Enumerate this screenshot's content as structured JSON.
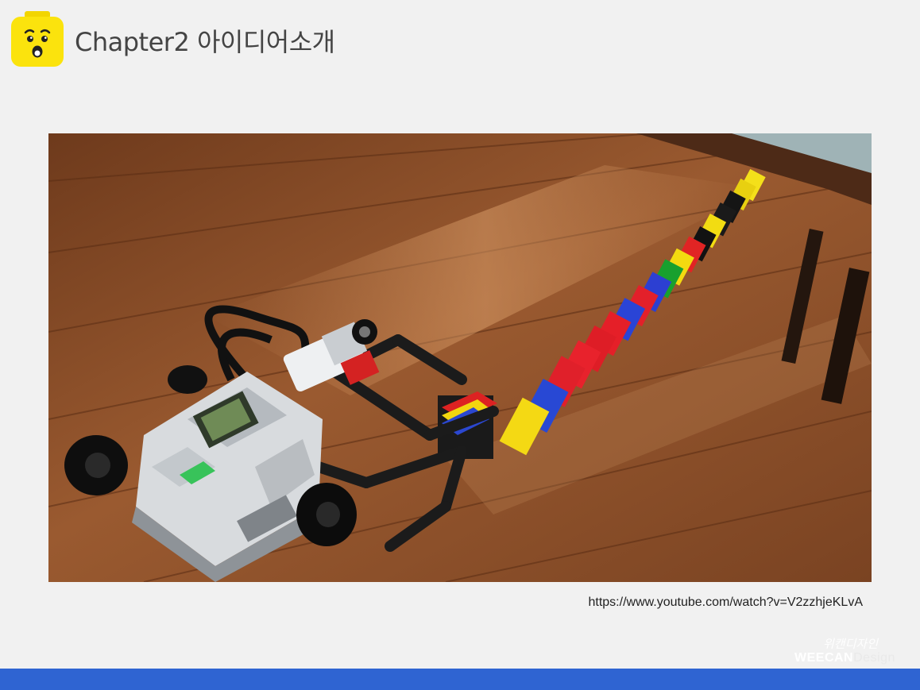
{
  "header": {
    "title": "Chapter2 아이디어소개"
  },
  "figure": {
    "source_url": "https://www.youtube.com/watch?v=V2zzhjeKLvA"
  },
  "watermark": {
    "script_text": "위캔디자인",
    "brand_bold": "WEECAN",
    "brand_light": "Design"
  },
  "colors": {
    "background": "#f1f1f1",
    "bottom_bar": "#2f64d2",
    "logo_yellow": "#fbe30d",
    "title_text": "#444444"
  },
  "icons": {
    "logo": "lego-minifig-surprised-face-icon"
  }
}
